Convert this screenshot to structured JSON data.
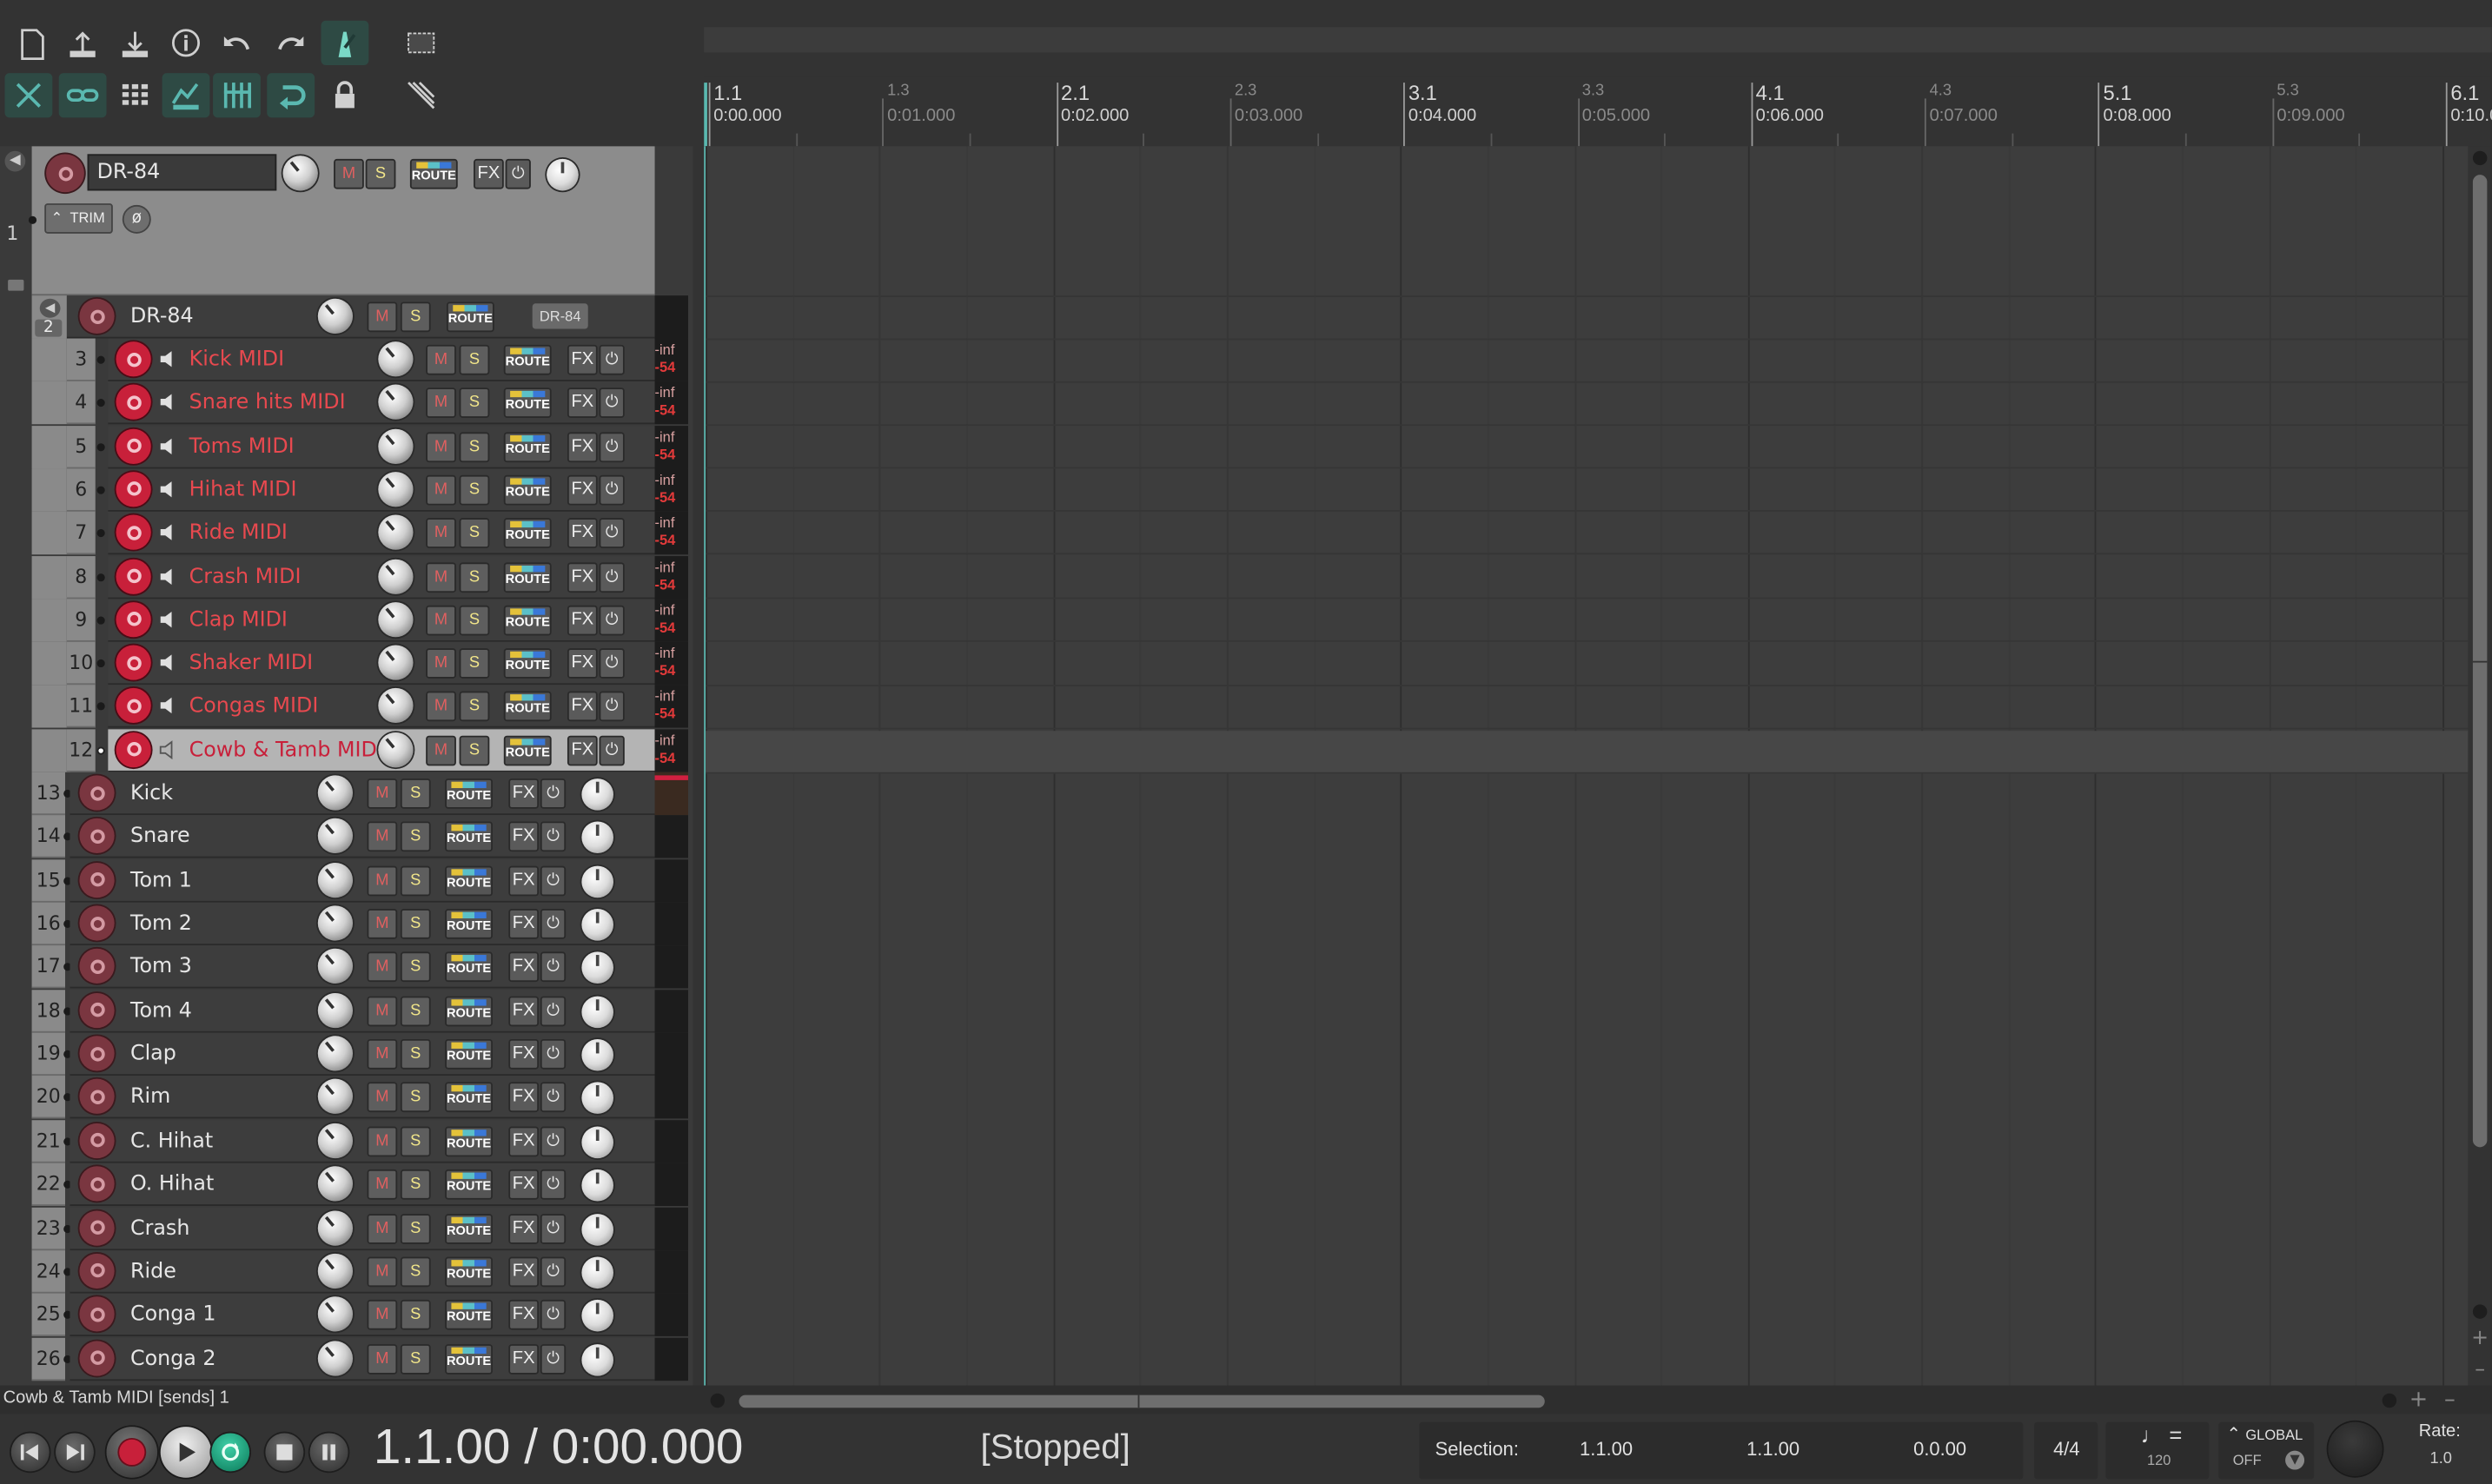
{
  "colors": {
    "accent": "#5ab8b0",
    "record_red": "#c8203a",
    "midi_track_text": "#e8494f",
    "selected_track_text": "#c8203a",
    "mute": "#e06060",
    "solo": "#f2e68a"
  },
  "toolbar": {
    "row1": [
      "new-project-icon",
      "open-project-icon",
      "save-project-icon",
      "project-info-icon",
      "undo-icon",
      "redo-icon",
      "metronome-icon",
      "marquee-icon"
    ],
    "row2": [
      "ripple-edit-icon",
      "item-grouping-icon",
      "grid-icon",
      "envelope-link-icon",
      "snap-icon",
      "loop-icon",
      "lock-icon",
      "cursor-icon"
    ]
  },
  "ruler": {
    "marks": [
      {
        "bar": "1.1",
        "time": "0:00.000"
      },
      {
        "bar": "1.3",
        "time": "0:01.000"
      },
      {
        "bar": "2.1",
        "time": "0:02.000"
      },
      {
        "bar": "2.3",
        "time": "0:03.000"
      },
      {
        "bar": "3.1",
        "time": "0:04.000"
      },
      {
        "bar": "3.3",
        "time": "0:05.000"
      },
      {
        "bar": "4.1",
        "time": "0:06.000"
      },
      {
        "bar": "4.3",
        "time": "0:07.000"
      },
      {
        "bar": "5.1",
        "time": "0:08.000"
      },
      {
        "bar": "5.3",
        "time": "0:09.000"
      },
      {
        "bar": "6.1",
        "time": "0:10.0"
      }
    ]
  },
  "track1": {
    "number": "1",
    "name": "DR-84",
    "trim_label": "TRIM",
    "phase_label": "ø"
  },
  "folder": {
    "number": "2",
    "name": "DR-84",
    "tag": "DR-84"
  },
  "buttons": {
    "mute": "M",
    "solo": "S",
    "route": "ROUTE",
    "fx": "FX",
    "power": "⏻"
  },
  "meter": {
    "peak": "-inf",
    "level": "-54"
  },
  "midi_tracks": [
    {
      "num": "3",
      "name": "Kick MIDI"
    },
    {
      "num": "4",
      "name": "Snare hits MIDI"
    },
    {
      "num": "5",
      "name": "Toms MIDI"
    },
    {
      "num": "6",
      "name": "Hihat MIDI"
    },
    {
      "num": "7",
      "name": "Ride MIDI"
    },
    {
      "num": "8",
      "name": "Crash MIDI"
    },
    {
      "num": "9",
      "name": "Clap MIDI"
    },
    {
      "num": "10",
      "name": "Shaker MIDI"
    },
    {
      "num": "11",
      "name": "Congas MIDI"
    },
    {
      "num": "12",
      "name": "Cowb & Tamb MIDI",
      "selected": true
    }
  ],
  "audio_tracks": [
    {
      "num": "13",
      "name": "Kick"
    },
    {
      "num": "14",
      "name": "Snare"
    },
    {
      "num": "15",
      "name": "Tom 1"
    },
    {
      "num": "16",
      "name": "Tom 2"
    },
    {
      "num": "17",
      "name": "Tom 3"
    },
    {
      "num": "18",
      "name": "Tom 4"
    },
    {
      "num": "19",
      "name": "Clap"
    },
    {
      "num": "20",
      "name": "Rim"
    },
    {
      "num": "21",
      "name": "C. Hihat"
    },
    {
      "num": "22",
      "name": "O. Hihat"
    },
    {
      "num": "23",
      "name": "Crash"
    },
    {
      "num": "24",
      "name": "Ride"
    },
    {
      "num": "25",
      "name": "Conga 1"
    },
    {
      "num": "26",
      "name": "Conga 2"
    }
  ],
  "status_line": "Cowb & Tamb MIDI [sends] 1",
  "transport": {
    "position": "1.1.00 / 0:00.000",
    "state": "[Stopped]",
    "selection_label": "Selection:",
    "selection_start": "1.1.00",
    "selection_end": "1.1.00",
    "selection_length": "0.0.00",
    "time_signature": "4/4",
    "tempo_symbol": "♩ =",
    "tempo": "120",
    "automation_mode": "GLOBAL",
    "automation_state": "OFF",
    "rate_label": "Rate:",
    "rate": "1.0"
  }
}
